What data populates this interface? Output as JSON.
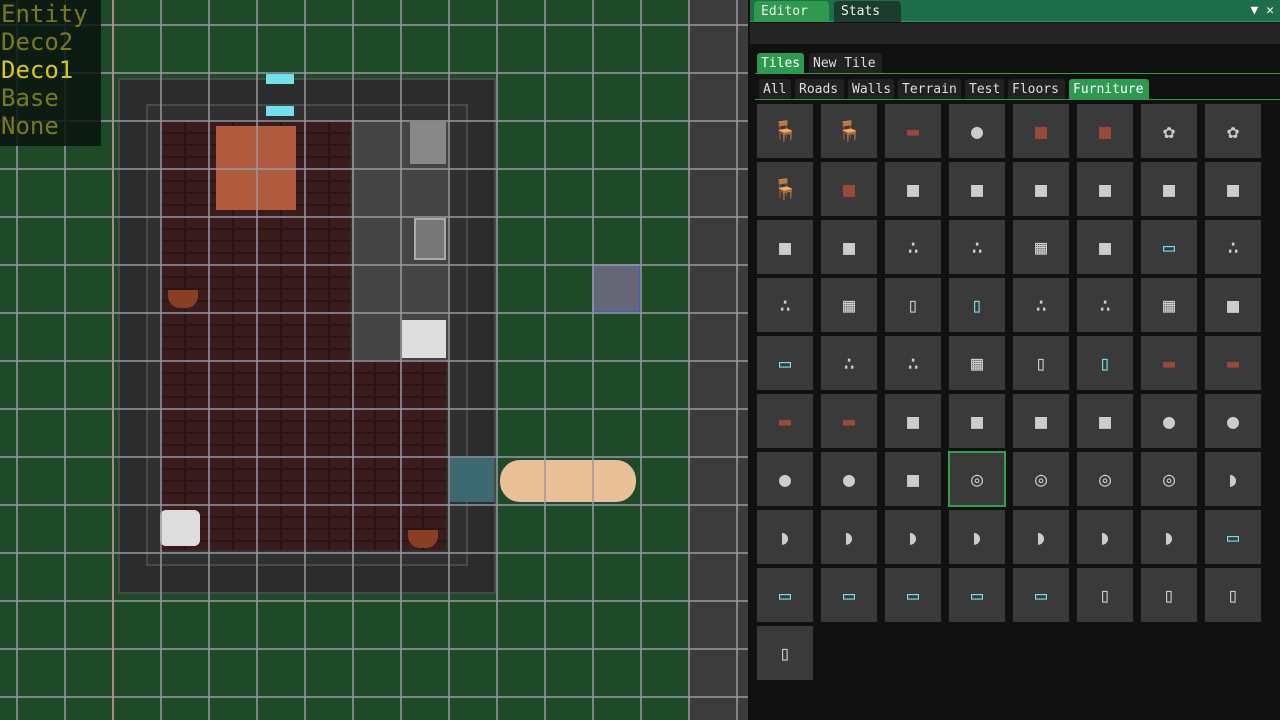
{
  "layers": {
    "items": [
      "Entity",
      "Deco2",
      "Deco1",
      "Base",
      "None"
    ],
    "active": "Deco1"
  },
  "window_tabs": [
    {
      "label": "Editor",
      "active": true
    },
    {
      "label": "Stats",
      "active": false
    }
  ],
  "window_icons": [
    "dropdown-icon",
    "close-icon"
  ],
  "main_tabs": [
    {
      "label": "Tiles",
      "active": true
    },
    {
      "label": "New Tile",
      "active": false
    }
  ],
  "category_tabs": [
    {
      "label": "All",
      "active": false
    },
    {
      "label": "Roads",
      "active": false
    },
    {
      "label": "Walls",
      "active": false
    },
    {
      "label": "Terrain",
      "active": false
    },
    {
      "label": "Test",
      "active": false
    },
    {
      "label": "Floors",
      "active": false
    },
    {
      "label": "Furniture",
      "active": true
    }
  ],
  "colors": {
    "accent": "#2e9a50",
    "titlebar": "#1f6e4b",
    "grass": "#1e4a28",
    "layer_active": "#d8c81c",
    "layer_inactive": "#7a7a1c"
  },
  "selected_tile": "washer-front",
  "tiles": [
    "chair",
    "chair",
    "table",
    "round-lamp",
    "dresser",
    "wardrobe",
    "plant-red",
    "plant-white",
    "chair-side",
    "bench",
    "sink",
    "fishbowl",
    "bottle",
    "faucet",
    "toilet",
    "bathtub",
    "bathtub-vertical",
    "bathtub-horizontal",
    "counter",
    "counter",
    "stove",
    "cabinet",
    "window-cabinet",
    "counter",
    "counter",
    "stove",
    "fridge",
    "fridge-glass",
    "counter",
    "counter",
    "stove",
    "cabinet",
    "window",
    "counter",
    "counter",
    "stove",
    "fridge",
    "fridge-glass",
    "table-set",
    "table-set-vertical",
    "table-set-horizontal",
    "table-set",
    "stool",
    "stool",
    "stool",
    "stool",
    "lamp-off",
    "lamp-off",
    "lamp",
    "lamp",
    "closet",
    "washer-front",
    "washer-side",
    "washer-top",
    "washer-side",
    "basin",
    "basin-left",
    "basin-bottom",
    "basin-right",
    "basin-top",
    "basin-left",
    "basin-bottom",
    "basin-right",
    "window-pair",
    "window-pair-horizontal",
    "window-horizontal",
    "window-horizontal",
    "window-vertical",
    "window-vertical",
    "door-horizontal",
    "door-vertical",
    "door-vertical",
    "door-horizontal"
  ]
}
